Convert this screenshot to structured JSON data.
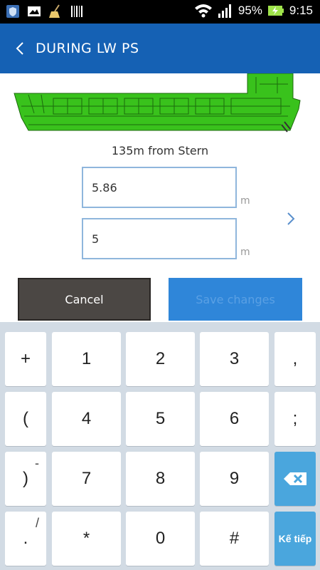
{
  "status_bar": {
    "battery_percent": "95%",
    "time": "9:15",
    "icons": [
      "shield-app-icon",
      "mail-icon",
      "broom-icon",
      "barcode-icon",
      "wifi-icon",
      "signal-icon",
      "battery-charging-icon"
    ]
  },
  "app_bar": {
    "title": "DURING LW PS",
    "back_icon": "chevron-left-icon"
  },
  "ship": {
    "hull_color": "#39c21c"
  },
  "form": {
    "position_label": "135m from Stern",
    "field1_value": "5.86",
    "field1_unit": "m",
    "field2_value": "5",
    "field2_unit": "m",
    "next_icon": "chevron-right-icon"
  },
  "buttons": {
    "cancel_label": "Cancel",
    "save_label": "Save changes"
  },
  "keyboard": {
    "row1": [
      "+",
      "1",
      "2",
      "3",
      ","
    ],
    "row2": [
      "(",
      "4",
      "5",
      "6",
      ";"
    ],
    "row3": [
      ")",
      "7",
      "8",
      "9"
    ],
    "row3_sup": "-",
    "row4": [
      ".",
      "*",
      "0",
      "#"
    ],
    "row4_sup": "/",
    "enter_label": "Kế tiếp",
    "delete_icon": "backspace-icon"
  }
}
